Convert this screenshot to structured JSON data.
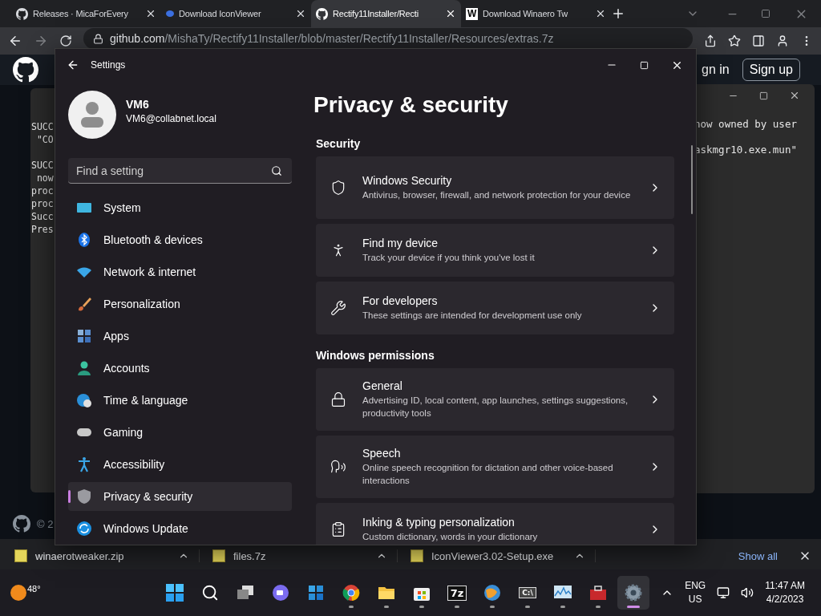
{
  "browser": {
    "tabs": [
      {
        "title": "Releases · MicaForEvery",
        "kind": "github",
        "selected": false
      },
      {
        "title": "Download IconViewer",
        "kind": "dot",
        "selected": false
      },
      {
        "title": "Rectify11Installer/Recti",
        "kind": "github",
        "selected": true
      },
      {
        "title": "Download Winaero Tw",
        "kind": "letter",
        "letter": "W",
        "selected": false
      }
    ],
    "url": {
      "host": "github.com",
      "path": "/MishaTy/Rectify11Installer/blob/master/Rectify11Installer/Resources/extras.7z"
    }
  },
  "github_header": {
    "sign_in": "gn in",
    "sign_up": "Sign up"
  },
  "console_left": {
    "blocks": [
      [
        "SUCC",
        " \"CO"
      ],
      [
        "SUCC",
        " now",
        "proc",
        "proc",
        "Succ",
        "Pres"
      ]
    ]
  },
  "console_right": {
    "blocks": [
      [
        "now owned by user"
      ],
      [
        "askmgr10.exe.mun\""
      ]
    ]
  },
  "footer": {
    "copyright": "© 2"
  },
  "settings": {
    "title": "Settings",
    "user": {
      "name": "VM6",
      "email": "VM6@collabnet.local"
    },
    "search": {
      "placeholder": "Find a setting"
    },
    "nav": [
      {
        "label": "System",
        "selected": false
      },
      {
        "label": "Bluetooth & devices",
        "selected": false
      },
      {
        "label": "Network & internet",
        "selected": false
      },
      {
        "label": "Personalization",
        "selected": false
      },
      {
        "label": "Apps",
        "selected": false
      },
      {
        "label": "Accounts",
        "selected": false
      },
      {
        "label": "Time & language",
        "selected": false
      },
      {
        "label": "Gaming",
        "selected": false
      },
      {
        "label": "Accessibility",
        "selected": false
      },
      {
        "label": "Privacy & security",
        "selected": true
      },
      {
        "label": "Windows Update",
        "selected": false
      }
    ],
    "heading": "Privacy & security",
    "sections": [
      {
        "title": "Security",
        "cards": [
          {
            "title": "Windows Security",
            "description": "Antivirus, browser, firewall, and network protection for your device"
          },
          {
            "title": "Find my device",
            "description": "Track your device if you think you've lost it"
          },
          {
            "title": "For developers",
            "description": "These settings are intended for development use only"
          }
        ]
      },
      {
        "title": "Windows permissions",
        "cards": [
          {
            "title": "General",
            "description": "Advertising ID, local content, app launches, settings suggestions, productivity tools"
          },
          {
            "title": "Speech",
            "description": "Online speech recognition for dictation and other voice-based interactions"
          },
          {
            "title": "Inking & typing personalization",
            "description": "Custom dictionary, words in your dictionary"
          }
        ]
      }
    ]
  },
  "downloads": {
    "items": [
      {
        "name": "winaerotweaker.zip"
      },
      {
        "name": "files.7z"
      },
      {
        "name": "IconViewer3.02-Setup.exe"
      }
    ],
    "show_all": "Show all"
  },
  "taskbar": {
    "weather": "48°",
    "apps": [
      {
        "kind": "start",
        "running": false,
        "selected": false
      },
      {
        "kind": "search",
        "running": false,
        "selected": false
      },
      {
        "kind": "taskview",
        "running": false,
        "selected": false
      },
      {
        "kind": "chat",
        "running": false,
        "selected": false
      },
      {
        "kind": "widgets",
        "running": false,
        "selected": false
      },
      {
        "kind": "chrome",
        "running": true,
        "selected": false
      },
      {
        "kind": "explorer",
        "running": true,
        "selected": false
      },
      {
        "kind": "store",
        "running": true,
        "selected": false
      },
      {
        "kind": "label",
        "label": "7z",
        "running": true,
        "selected": false
      },
      {
        "kind": "globe",
        "running": true,
        "selected": false
      },
      {
        "kind": "terminal",
        "label": "C:\\",
        "running": true,
        "selected": false
      },
      {
        "kind": "monitor",
        "running": true,
        "selected": false
      },
      {
        "kind": "toolbox",
        "running": true,
        "selected": false
      },
      {
        "kind": "settings",
        "running": true,
        "selected": true
      }
    ],
    "language": "ENG",
    "region": "US",
    "time": "11:47 AM",
    "date": "4/2/2023"
  }
}
